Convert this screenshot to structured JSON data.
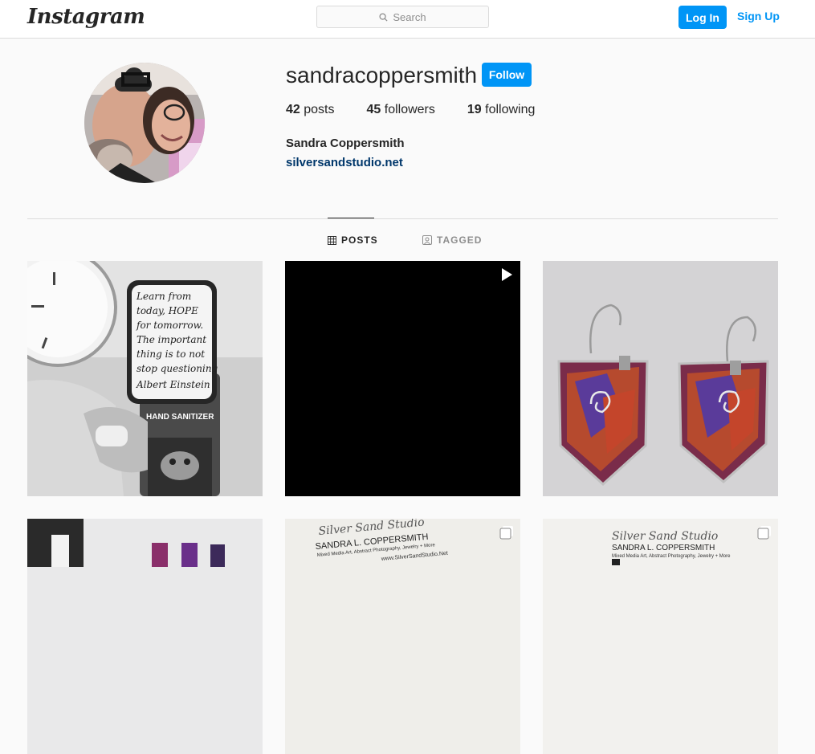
{
  "header": {
    "logo_text": "Instagram",
    "search_placeholder": "Search",
    "login_label": "Log In",
    "signup_label": "Sign Up"
  },
  "profile": {
    "username": "sandracoppersmith",
    "follow_label": "Follow",
    "posts_count": "42",
    "posts_label": "posts",
    "followers_count": "45",
    "followers_label": "followers",
    "following_count": "19",
    "following_label": "following",
    "full_name": "Sandra Coppersmith",
    "website": "silversandstudio.net"
  },
  "tabs": {
    "posts": "POSTS",
    "tagged": "TAGGED"
  },
  "posts": [
    {
      "kind": "image",
      "note": "hand sanitizer",
      "card_lines": [
        "Learn from",
        "today, HOPE",
        "for tomorrow.",
        "The important",
        "thing is to not",
        "stop questioning",
        "Albert Einstein"
      ],
      "label": "HAND SANITIZER"
    },
    {
      "kind": "video"
    },
    {
      "kind": "image"
    },
    {
      "kind": "image"
    },
    {
      "kind": "carousel",
      "studio": "Silver Sand Studio",
      "name": "SANDRA L. COPPERSMITH",
      "tagline": "Mixed Media Art, Abstract Photography, Jewelry + More",
      "site": "www.SilverSandStudio.Net"
    },
    {
      "kind": "carousel",
      "studio": "Silver Sand Studio",
      "name": "SANDRA L. COPPERSMITH",
      "tagline": "Mixed Media Art, Abstract Photography, Jewelry + More"
    }
  ],
  "colors": {
    "accent": "#0095f6",
    "link": "#00376b",
    "border": "#dbdbdb",
    "background": "#fafafa"
  },
  "icons": {
    "search": "magnifier-icon",
    "posts_tab": "grid-icon",
    "tagged_tab": "tag-person-icon",
    "video_badge": "play-icon",
    "carousel_badge": "multiple-images-icon"
  }
}
